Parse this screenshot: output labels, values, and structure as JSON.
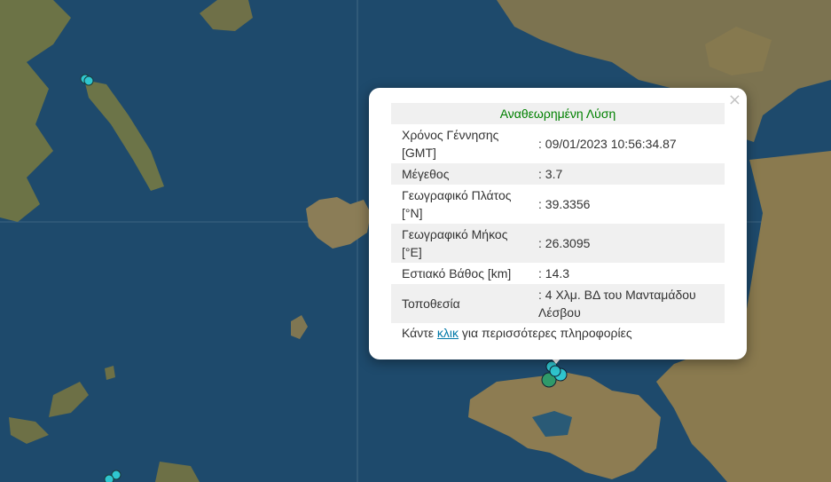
{
  "popup": {
    "close_glyph": "×",
    "header": "Αναθεωρημένη Λύση",
    "rows": [
      {
        "label": "Χρόνος Γέννησης [GMT]",
        "value": ": 09/01/2023 10:56:34.87"
      },
      {
        "label": "Μέγεθος",
        "value": ": 3.7"
      },
      {
        "label": "Γεωγραφικό Πλάτος [°N]",
        "value": ": 39.3356"
      },
      {
        "label": "Γεωγραφικό Μήκος [°E]",
        "value": ": 26.3095"
      },
      {
        "label": "Εστιακό Βάθος [km]",
        "value": ": 14.3"
      },
      {
        "label": "Τοποθεσία",
        "value": ": 4 Χλμ. ΒΔ του Μανταμάδου Λέσβου"
      }
    ],
    "more_prefix": "Κάντε ",
    "more_link": "κλικ",
    "more_suffix": " για περισσότερες πληροφορίες"
  },
  "colors": {
    "sea": "#1e4a6c",
    "land": "#8a7a55",
    "marker_cyan": "#2fc6cf",
    "marker_green": "#2f9a6a",
    "header_green": "#008000",
    "link": "#0078a8"
  }
}
